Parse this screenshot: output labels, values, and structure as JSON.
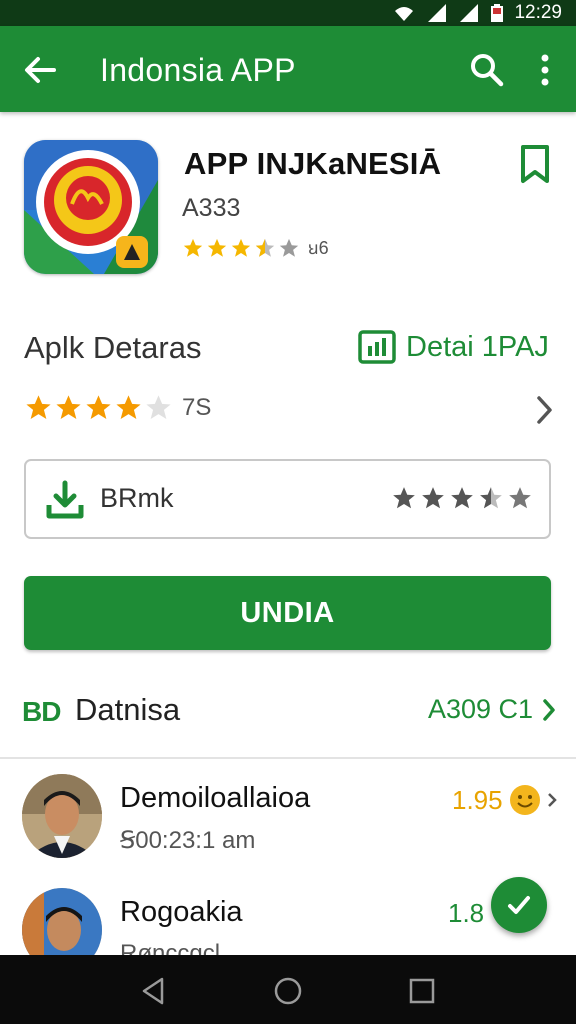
{
  "status_bar": {
    "time": "12:29"
  },
  "app_bar": {
    "title": "Indonsia APP"
  },
  "app": {
    "name": "APP INJKaNESIĀ",
    "subtitle": "A333",
    "stars": 3.5,
    "rating_count": "ꞟ6"
  },
  "details": {
    "label": "Aplk Detaras",
    "link": "Detai 1PAJ",
    "stars": 4,
    "count": "7S"
  },
  "download": {
    "label": "BRmk",
    "stars": 3.5
  },
  "install": {
    "label": "UNDIA"
  },
  "section": {
    "icon": "BD",
    "title": "Datnisa",
    "link": "A309 C1"
  },
  "reviews": [
    {
      "name": "Demoiloallaioa",
      "time": "Ꞩ00:23:1 am",
      "score": "1.95"
    },
    {
      "name": "Rogoakia",
      "time": "Rønccgcl",
      "score": "1.8"
    }
  ],
  "colors": {
    "brand": "#1e8c36",
    "status_bar": "#0f3a16",
    "star": "#f5b700"
  },
  "icons": [
    "back-arrow-icon",
    "search-icon",
    "more-vert-icon",
    "bookmark-icon",
    "chart-icon",
    "chevron-right-icon",
    "download-icon",
    "smiley-icon",
    "check-icon"
  ]
}
